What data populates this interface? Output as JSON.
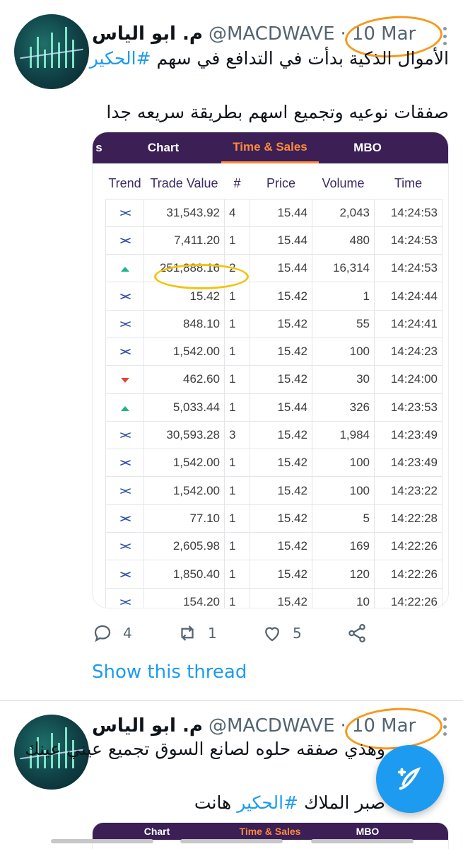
{
  "tweets": [
    {
      "name": "م. ابو الياس",
      "handle": "@MACDWAVE",
      "separator": "·",
      "date": "10 Mar",
      "line1_pre": "الأموال الذكية بدأت في التدافع في سهم ",
      "line1_hashtag": "#الحكير",
      "line2": "صفقات نوعيه وتجميع اسهم بطريقة سريعه جدا"
    },
    {
      "name": "م. ابو الياس",
      "handle": "@MACDWAVE",
      "separator": "·",
      "date": "10 Mar",
      "line1": "وهذي صفقه حلوه لصانع السوق تجميع عيني عينك",
      "line2_pre": "صبر ",
      "line2_hidden": "الملاك",
      "line2_hashtag": "#الحكير",
      "line2_post": " هانت"
    }
  ],
  "card": {
    "tabs": [
      "s",
      "Chart",
      "Time & Sales",
      "MBO",
      ""
    ],
    "active_tab": "Time & Sales",
    "headers": [
      "Trend",
      "Trade Value",
      "#",
      "Price",
      "Volume",
      "Time"
    ],
    "rows": [
      {
        "trend": "cross",
        "value": "31,543.92",
        "count": "4",
        "price": "15.44",
        "volume": "2,043",
        "time": "14:24:53"
      },
      {
        "trend": "cross",
        "value": "7,411.20",
        "count": "1",
        "price": "15.44",
        "volume": "480",
        "time": "14:24:53"
      },
      {
        "trend": "up",
        "value": "251,888.16",
        "count": "2",
        "price": "15.44",
        "volume": "16,314",
        "time": "14:24:53"
      },
      {
        "trend": "cross",
        "value": "15.42",
        "count": "1",
        "price": "15.42",
        "volume": "1",
        "time": "14:24:44"
      },
      {
        "trend": "cross",
        "value": "848.10",
        "count": "1",
        "price": "15.42",
        "volume": "55",
        "time": "14:24:41"
      },
      {
        "trend": "cross",
        "value": "1,542.00",
        "count": "1",
        "price": "15.42",
        "volume": "100",
        "time": "14:24:23"
      },
      {
        "trend": "down",
        "value": "462.60",
        "count": "1",
        "price": "15.42",
        "volume": "30",
        "time": "14:24:00"
      },
      {
        "trend": "up",
        "value": "5,033.44",
        "count": "1",
        "price": "15.44",
        "volume": "326",
        "time": "14:23:53"
      },
      {
        "trend": "cross",
        "value": "30,593.28",
        "count": "3",
        "price": "15.42",
        "volume": "1,984",
        "time": "14:23:49"
      },
      {
        "trend": "cross",
        "value": "1,542.00",
        "count": "1",
        "price": "15.42",
        "volume": "100",
        "time": "14:23:49"
      },
      {
        "trend": "cross",
        "value": "1,542.00",
        "count": "1",
        "price": "15.42",
        "volume": "100",
        "time": "14:23:22"
      },
      {
        "trend": "cross",
        "value": "77.10",
        "count": "1",
        "price": "15.42",
        "volume": "5",
        "time": "14:22:28"
      },
      {
        "trend": "cross",
        "value": "2,605.98",
        "count": "1",
        "price": "15.42",
        "volume": "169",
        "time": "14:22:26"
      },
      {
        "trend": "cross",
        "value": "1,850.40",
        "count": "1",
        "price": "15.42",
        "volume": "120",
        "time": "14:22:26"
      },
      {
        "trend": "cross",
        "value": "154.20",
        "count": "1",
        "price": "15.42",
        "volume": "10",
        "time": "14:22:26"
      }
    ],
    "second_tabs": [
      "Chart",
      "Time & Sales",
      "MBO"
    ]
  },
  "actions": {
    "replies": "4",
    "retweets": "1",
    "likes": "5"
  },
  "show_thread": "Show this thread",
  "colors": {
    "accent": "#1d9bf0",
    "tab_bar": "#3b1f55",
    "active_tab": "#ff8a3c",
    "annotation_orange": "#f59a1c",
    "annotation_yellow": "#f1c40f"
  },
  "icons": [
    "more-icon",
    "reply-icon",
    "retweet-icon",
    "like-icon",
    "share-icon",
    "compose-tweet-icon"
  ]
}
